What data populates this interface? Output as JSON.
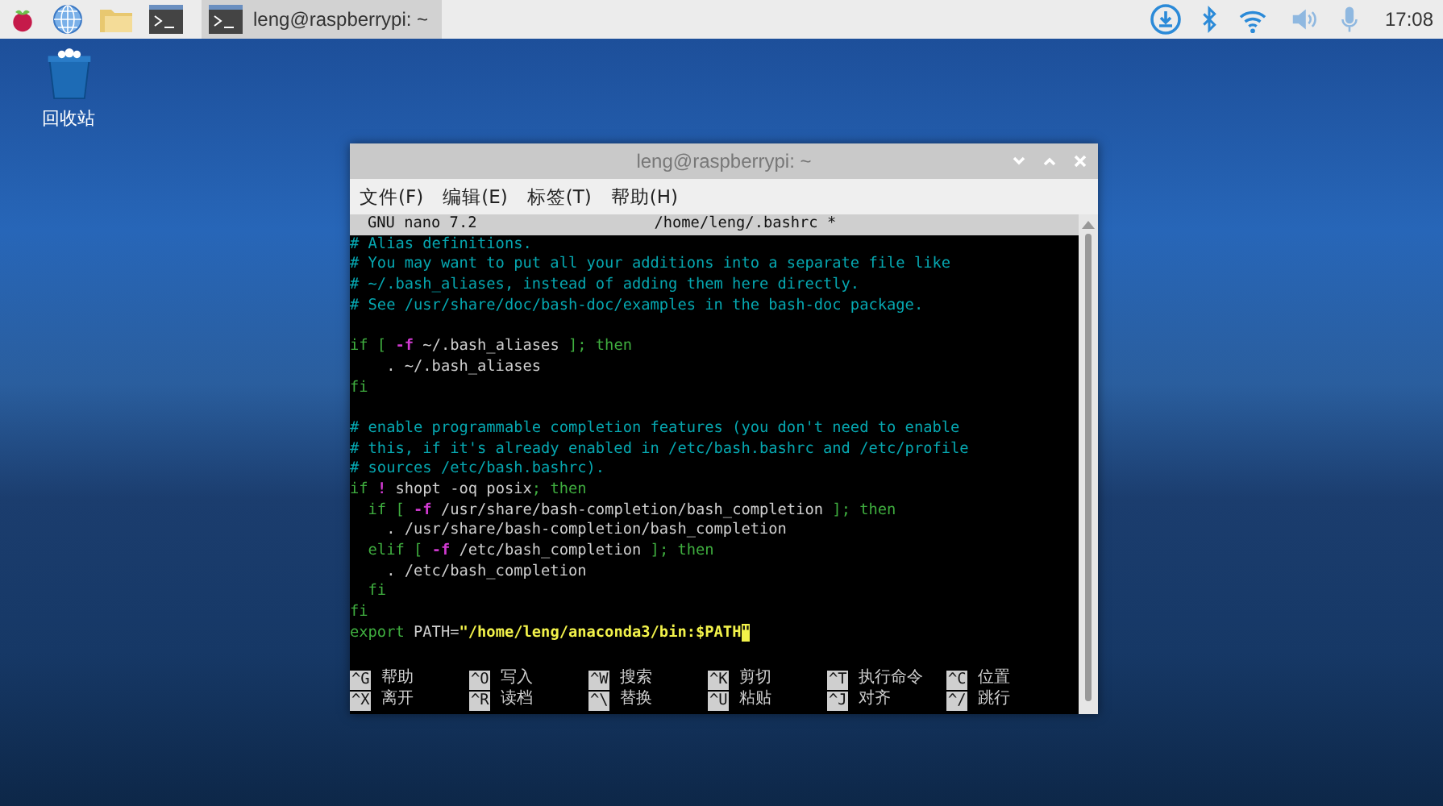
{
  "taskbar": {
    "window_button": {
      "label": "leng@raspberrypi: ~",
      "selected": true
    },
    "clock": "17:08"
  },
  "desktop_icons": [
    {
      "label": "回收站"
    }
  ],
  "window": {
    "title": "leng@raspberrypi: ~",
    "menu": [
      {
        "label": "文件(F)"
      },
      {
        "label": "编辑(E)"
      },
      {
        "label": "标签(T)"
      },
      {
        "label": "帮助(H)"
      }
    ],
    "nano": {
      "version": "GNU nano 7.2",
      "file": "/home/leng/.bashrc *",
      "lines": [
        {
          "segments": [
            {
              "kind": "comment",
              "text": "# Alias definitions."
            }
          ]
        },
        {
          "segments": [
            {
              "kind": "comment",
              "text": "# You may want to put all your additions into a separate file like"
            }
          ]
        },
        {
          "segments": [
            {
              "kind": "comment",
              "text": "# ~/.bash_aliases, instead of adding them here directly."
            }
          ]
        },
        {
          "segments": [
            {
              "kind": "comment",
              "text": "# See /usr/share/doc/bash-doc/examples in the bash-doc package."
            }
          ]
        },
        {
          "kind": "blank"
        },
        {
          "segments": [
            {
              "kind": "keyword",
              "text": "if [ "
            },
            {
              "kind": "flag",
              "text": "-f"
            },
            {
              "kind": "plain",
              "text": " ~/.bash_aliases "
            },
            {
              "kind": "keyword",
              "text": "]; then"
            }
          ]
        },
        {
          "segments": [
            {
              "kind": "plain",
              "text": "    . ~/.bash_aliases"
            }
          ]
        },
        {
          "segments": [
            {
              "kind": "keyword",
              "text": "fi"
            }
          ]
        },
        {
          "kind": "blank"
        },
        {
          "segments": [
            {
              "kind": "comment",
              "text": "# enable programmable completion features (you don't need to enable"
            }
          ]
        },
        {
          "segments": [
            {
              "kind": "comment",
              "text": "# this, if it's already enabled in /etc/bash.bashrc and /etc/profile"
            }
          ]
        },
        {
          "segments": [
            {
              "kind": "comment",
              "text": "# sources /etc/bash.bashrc)."
            }
          ]
        },
        {
          "segments": [
            {
              "kind": "keyword",
              "text": "if"
            },
            {
              "kind": "flag",
              "text": " ! "
            },
            {
              "kind": "plain",
              "text": "shopt -oq posix"
            },
            {
              "kind": "keyword",
              "text": "; then"
            }
          ]
        },
        {
          "segments": [
            {
              "kind": "keyword",
              "text": "  if [ "
            },
            {
              "kind": "flag",
              "text": "-f"
            },
            {
              "kind": "plain",
              "text": " /usr/share/bash-completion/bash_completion "
            },
            {
              "kind": "keyword",
              "text": "]; then"
            }
          ]
        },
        {
          "segments": [
            {
              "kind": "plain",
              "text": "    . /usr/share/bash-completion/bash_completion"
            }
          ]
        },
        {
          "segments": [
            {
              "kind": "keyword",
              "text": "  elif [ "
            },
            {
              "kind": "flag",
              "text": "-f"
            },
            {
              "kind": "plain",
              "text": " /etc/bash_completion "
            },
            {
              "kind": "keyword",
              "text": "]; then"
            }
          ]
        },
        {
          "segments": [
            {
              "kind": "plain",
              "text": "    . /etc/bash_completion"
            }
          ]
        },
        {
          "segments": [
            {
              "kind": "keyword",
              "text": "  fi"
            }
          ]
        },
        {
          "segments": [
            {
              "kind": "keyword",
              "text": "fi"
            }
          ]
        },
        {
          "segments": [
            {
              "kind": "keyword",
              "text": "export"
            },
            {
              "kind": "plain",
              "text": " PATH="
            },
            {
              "kind": "string",
              "text": "\"/home/leng/anaconda3/bin:$PATH"
            },
            {
              "kind": "cursor",
              "text": "\""
            }
          ]
        }
      ],
      "shortcuts": [
        {
          "key": "^G",
          "label": "帮助"
        },
        {
          "key": "^O",
          "label": "写入"
        },
        {
          "key": "^W",
          "label": "搜索"
        },
        {
          "key": "^K",
          "label": "剪切"
        },
        {
          "key": "^T",
          "label": "执行命令"
        },
        {
          "key": "^C",
          "label": "位置"
        },
        {
          "key": "^X",
          "label": "离开"
        },
        {
          "key": "^R",
          "label": "读档"
        },
        {
          "key": "^\\",
          "label": "替换"
        },
        {
          "key": "^U",
          "label": "粘贴"
        },
        {
          "key": "^J",
          "label": "对齐"
        },
        {
          "key": "^/",
          "label": "跳行"
        }
      ]
    }
  }
}
